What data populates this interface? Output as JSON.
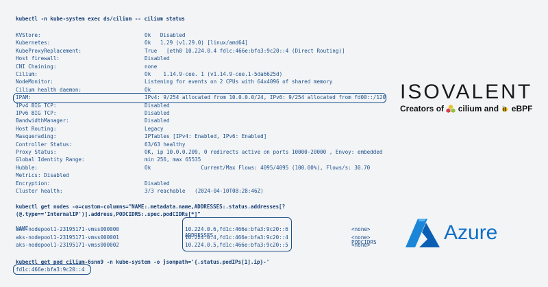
{
  "cmd1": "kubectl -n kube-system exec ds/cilium -- cilium status",
  "status_rows": [
    {
      "key": "KVStore:",
      "value": "Ok   Disabled"
    },
    {
      "key": "Kubernetes:",
      "value": "Ok   1.29 (v1.29.0) [linux/amd64]"
    },
    {
      "key": "KubeProxyReplacement:",
      "value": "True   [eth0 10.224.0.4 fdlc:466e:bfa3:9c20::4 (Direct Routing)]"
    },
    {
      "key": "Host firewall:",
      "value": "Disabled"
    },
    {
      "key": "CNI Chaining:",
      "value": "none"
    },
    {
      "key": "Cilium:",
      "value": "Ok    1.14.9-cee. 1 (v1.14.9-cee.1-5da6625d)"
    },
    {
      "key": "NodeMonitor:",
      "value": "Listening for events on 2 CPUs with 64x4096 of shared memory"
    },
    {
      "key": "Cilium health daemon:",
      "value": "Ok"
    },
    {
      "key": "IPAM:",
      "value": "IPv4: 9/254 allocated from 10.0.0.0/24, IPv6: 9/254 allocated from fd00::/120"
    },
    {
      "key": "IPv4 BIG TCP:",
      "value": "Disabled"
    },
    {
      "key": "IPv6 BIG TCP:",
      "value": "Disabled"
    },
    {
      "key": "BandwidthManager:",
      "value": "Disabled"
    },
    {
      "key": "Host Routing:",
      "value": "Legacy"
    },
    {
      "key": "Masquerading:",
      "value": "IPTables [IPv4: Enabled, IPv6: Enabled]"
    },
    {
      "key": "Controller Status:",
      "value": "63/63 healthy"
    },
    {
      "key": "Proxy Status:",
      "value": "OK, ip 10.0.0.209, 0 redirects active on ports 10000-20000 , Envoy: embedded"
    },
    {
      "key": "Global Identity Range:",
      "value": "min 256, max 65535"
    },
    {
      "key": "Hubble:",
      "value": "Ok                Current/Max Flows: 4095/4095 (100.00%), Flows/s: 30.70"
    },
    {
      "key": "Metrics: Disabled",
      "value": ""
    },
    {
      "key": "Encryption:",
      "value": "Disabled"
    },
    {
      "key": "Cluster health:",
      "value": "3/3 reachable   (2024-04-10T08:28:46Z)"
    }
  ],
  "cmd2_line1": "kubectl get nodes -o=custom-columns=\"NAME:.metadata.name,ADDRESSES:.status.addresses[?",
  "cmd2_line2": "(@.type=='InternalIP')].address,PODCIDRS:.spec.podCIDRs[*]\"",
  "nodes_headers": [
    "NAME",
    "ADDRESSES",
    "PODCIDRS"
  ],
  "nodes_rows": [
    [
      "aks-nodepool1-23195171-vmss000000",
      "10.224.0.6,fd1c:466e:bfa3:9c20::6",
      "<none>"
    ],
    [
      "aks-nodepool1-23195171-vmss000001",
      "10.224.0.4,fd1c:466e:bfa3:9c20::4",
      "<none>"
    ],
    [
      "aks-nodepool1-23195171-vmss000002",
      "10.224.0.5,fd1c:466e:bfa3:9c20::5",
      "<none>"
    ]
  ],
  "cmd3": "kubectl get pod cilium-6snn9 -n kube-system -o jsonpath='{.status.podIPs[1].ip}-'",
  "pod_ip": "fd1c:466e:bfa3:9c20::4",
  "isovalent": {
    "name": "ISOVALENT",
    "tagline_prefix": "Creators of",
    "cilium": "cilium",
    "and": "and",
    "ebpf": "eBPF"
  },
  "azure": {
    "name": "Azure"
  },
  "colors": {
    "text": "#1d4f8a",
    "background": "#f2f4f6",
    "azure": "#0f6fc6"
  }
}
